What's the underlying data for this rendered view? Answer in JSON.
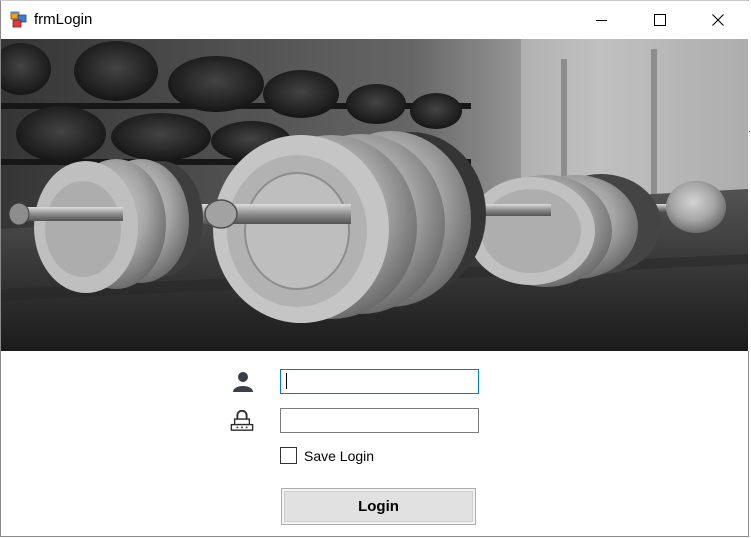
{
  "window": {
    "title": "frmLogin",
    "app_icon": "winforms-app-icon",
    "controls": {
      "minimize": "minimize-icon",
      "maximize": "maximize-icon",
      "close": "close-icon"
    }
  },
  "hero": {
    "image": "gym-dumbbells-photo"
  },
  "form": {
    "username": {
      "icon": "user-icon",
      "value": ""
    },
    "password": {
      "icon": "lock-icon",
      "value": ""
    },
    "save_login": {
      "label": "Save Login",
      "checked": false
    },
    "login_button": {
      "label": "Login"
    }
  },
  "colors": {
    "focus_border": "#0078d7",
    "input_border": "#7a7a7a",
    "button_face": "#e1e1e1",
    "background": "#ffffff"
  }
}
